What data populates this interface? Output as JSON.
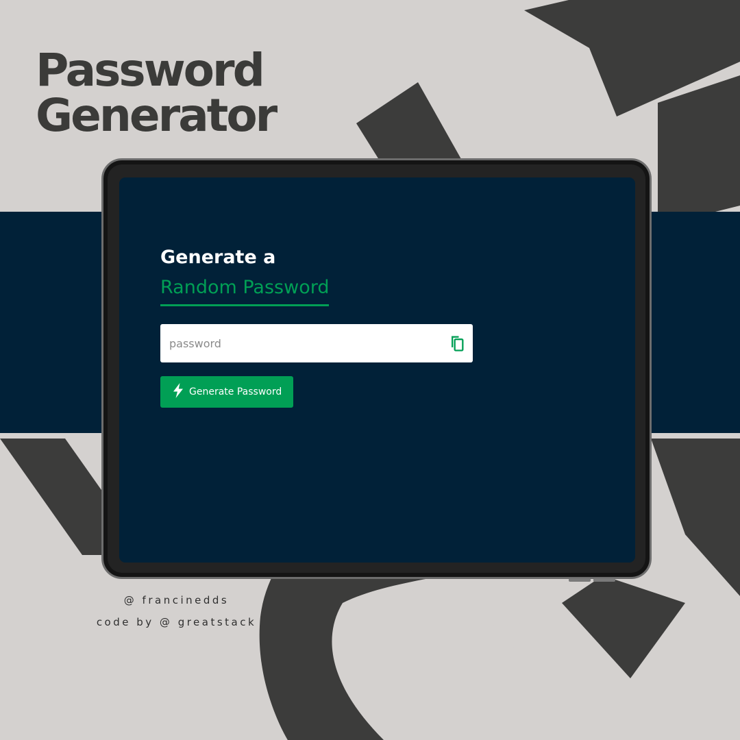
{
  "poster": {
    "title_line1": "Password",
    "title_line2": "Generator",
    "credit_author": "@ francinedds",
    "credit_code": "code by @ greatstack"
  },
  "app": {
    "heading_line1": "Generate a",
    "heading_line2": "Random Password",
    "password_input": {
      "value": "",
      "placeholder": "password"
    },
    "copy_icon": "copy-icon",
    "generate_button": {
      "icon": "lightning-icon",
      "label": "Generate Password"
    }
  },
  "colors": {
    "background": "#d4d1cf",
    "navy": "#012138",
    "accent_green": "#019f55",
    "dark_text": "#3b3b39",
    "white": "#ffffff"
  }
}
